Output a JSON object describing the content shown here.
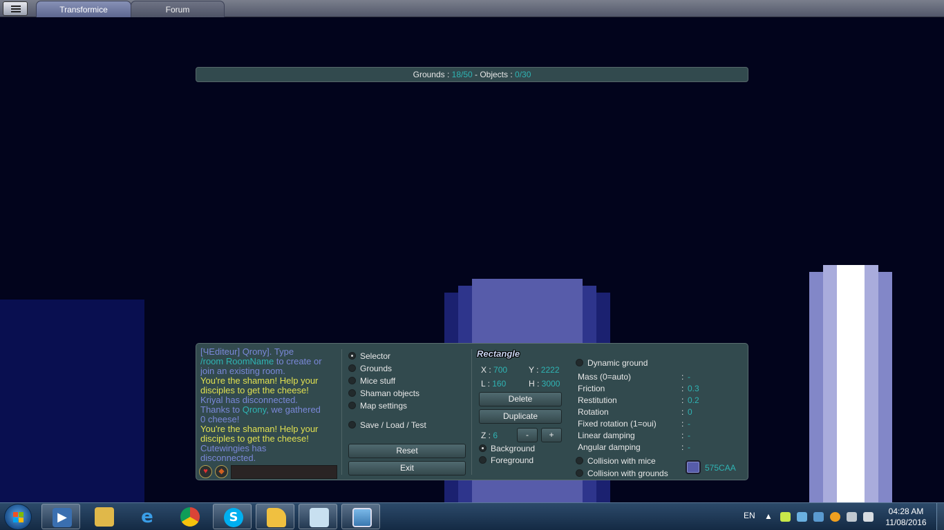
{
  "tabs": [
    {
      "label": "Transformice",
      "active": true
    },
    {
      "label": "Forum",
      "active": false
    }
  ],
  "counter": {
    "grounds_label": "Grounds : ",
    "grounds_value": "18/50",
    "sep": " - Objects : ",
    "objects_value": "0/30"
  },
  "chat": {
    "lines": [
      {
        "text": "[ЧEditeur] Qrony]. Type",
        "color": "blue"
      },
      {
        "text": "/room RoomName",
        "color": "cyan",
        "suffix": " to create or"
      },
      {
        "text": "join an existing room.",
        "color": "blue"
      },
      {
        "text": "You're the shaman! Help your",
        "color": "yellow"
      },
      {
        "text": "disciples to get the cheese!",
        "color": "yellow"
      },
      {
        "text": "Kriyal has disconnected.",
        "color": "blue"
      },
      {
        "text": "Thanks to ",
        "color": "blue",
        "name": "Qrony",
        "suffix": ", we gathered"
      },
      {
        "text": "0 cheese!",
        "color": "blue"
      },
      {
        "text": "You're the shaman! Help your",
        "color": "yellow"
      },
      {
        "text": "disciples to get the cheese!",
        "color": "yellow"
      },
      {
        "text": "Cutewingies has",
        "color": "blue"
      },
      {
        "text": "disconnected.",
        "color": "blue"
      }
    ]
  },
  "tools": {
    "selector": "Selector",
    "grounds": "Grounds",
    "mice_stuff": "Mice stuff",
    "shaman_objects": "Shaman objects",
    "map_settings": "Map settings",
    "save_load_test": "Save / Load / Test",
    "reset": "Reset",
    "exit": "Exit"
  },
  "shape": {
    "title": "Rectangle",
    "x_label": "X : ",
    "x": "700",
    "y_label": "Y : ",
    "y": "2222",
    "l_label": "L : ",
    "l": "160",
    "h_label": "H : ",
    "h": "3000",
    "delete": "Delete",
    "duplicate": "Duplicate",
    "z_label": "Z : ",
    "z": "6",
    "minus": "-",
    "plus": "+",
    "background": "Background",
    "foreground": "Foreground"
  },
  "props": {
    "dynamic_ground": "Dynamic ground",
    "rows": [
      {
        "label": "Mass (0=auto)",
        "value": "-"
      },
      {
        "label": "Friction",
        "value": "0.3"
      },
      {
        "label": "Restitution",
        "value": "0.2"
      },
      {
        "label": "Rotation",
        "value": "0"
      },
      {
        "label": "Fixed rotation (1=oui)",
        "value": "-"
      },
      {
        "label": "Linear damping",
        "value": "-"
      },
      {
        "label": "Angular damping",
        "value": "-"
      }
    ],
    "colon": ":",
    "collision_mice": "Collision with mice",
    "collision_grounds": "Collision with grounds",
    "color_hex": "575CAA",
    "color": "#575CAA"
  },
  "taskbar": {
    "language": "EN",
    "time": "04:28 AM",
    "date": "11/08/2016"
  }
}
